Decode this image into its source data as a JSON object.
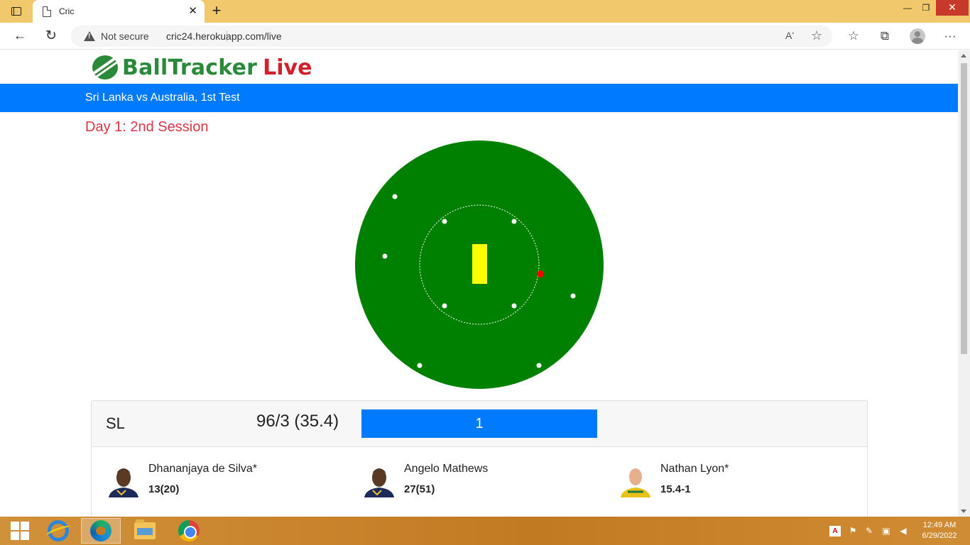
{
  "browser": {
    "tab_title": "Cric",
    "close_tab": "✕",
    "new_tab": "+",
    "security_label": "Not secure",
    "url": "cric24.herokuapp.com/live",
    "read_aloud": "Aʻ",
    "minimize": "—",
    "restore": "❐",
    "close_window": "✕",
    "back": "←",
    "refresh": "↻",
    "add_favorite": "☆",
    "favorites": "☆",
    "collections": "⧉",
    "more": "···"
  },
  "site": {
    "logo_part1": "BallTracker",
    "logo_part2": "Live",
    "match_title": "Sri Lanka vs Australia, 1st Test",
    "session": "Day 1: 2nd Session"
  },
  "field": {
    "outfield_color": "#008000",
    "pitch_color": "#ffff00",
    "ball_color": "#ff0000",
    "fielder_color": "#ffffff"
  },
  "scorecard": {
    "team": "SL",
    "score": "96/3 (35.4)",
    "last_ball": "1",
    "players": [
      {
        "name": "Dhananjaya de Silva*",
        "stat": "13(20)",
        "role": "batsman"
      },
      {
        "name": "Angelo Mathews",
        "stat": "27(51)",
        "role": "batsman"
      },
      {
        "name": "Nathan Lyon*",
        "stat": "15.4-1",
        "role": "bowler"
      }
    ]
  },
  "taskbar": {
    "time": "12:49 AM",
    "date": "6/29/2022"
  }
}
